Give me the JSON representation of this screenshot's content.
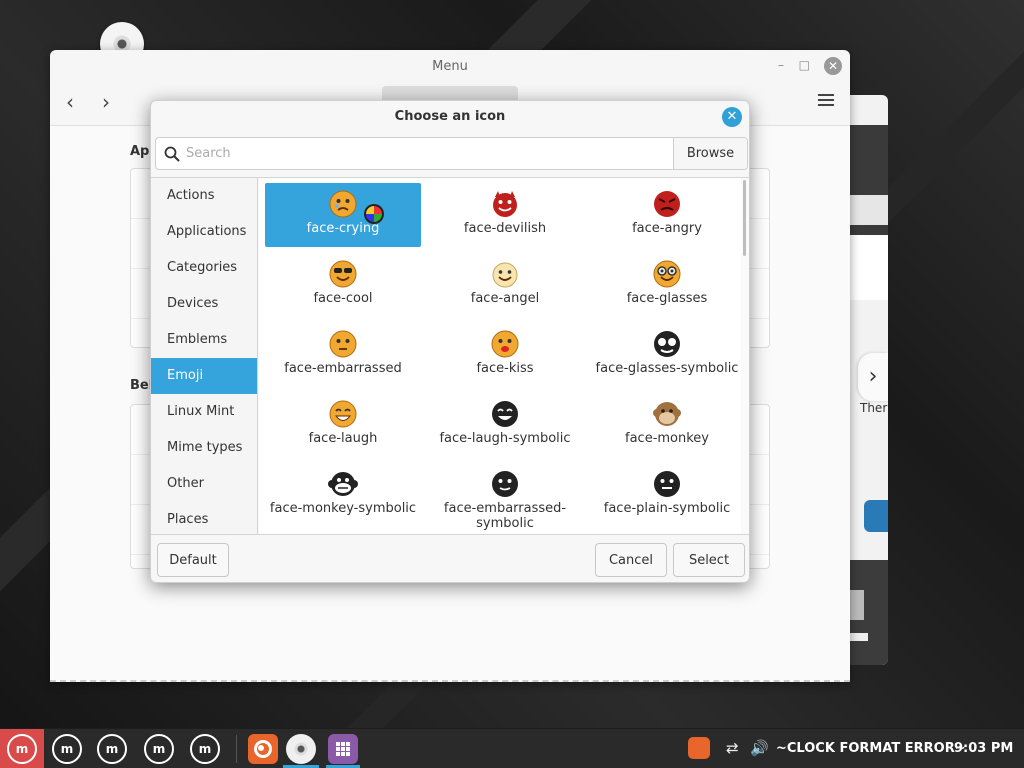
{
  "menu_window": {
    "title": "Menu",
    "section1_label": "App",
    "section2_label": "Beh"
  },
  "bg_window": {
    "theme_label": "Ther"
  },
  "dialog": {
    "title": "Choose an icon",
    "search_placeholder": "Search",
    "browse_label": "Browse",
    "categories": [
      {
        "label": "Actions",
        "active": false
      },
      {
        "label": "Applications",
        "active": false
      },
      {
        "label": "Categories",
        "active": false
      },
      {
        "label": "Devices",
        "active": false
      },
      {
        "label": "Emblems",
        "active": false
      },
      {
        "label": "Emoji",
        "active": true
      },
      {
        "label": "Linux Mint",
        "active": false
      },
      {
        "label": "Mime types",
        "active": false
      },
      {
        "label": "Other",
        "active": false
      },
      {
        "label": "Places",
        "active": false
      }
    ],
    "icons": [
      {
        "name": "face-crying",
        "selected": true
      },
      {
        "name": "face-devilish",
        "selected": false
      },
      {
        "name": "face-angry",
        "selected": false
      },
      {
        "name": "face-cool",
        "selected": false
      },
      {
        "name": "face-angel",
        "selected": false
      },
      {
        "name": "face-glasses",
        "selected": false
      },
      {
        "name": "face-embarrassed",
        "selected": false
      },
      {
        "name": "face-kiss",
        "selected": false
      },
      {
        "name": "face-glasses-symbolic",
        "selected": false
      },
      {
        "name": "face-laugh",
        "selected": false
      },
      {
        "name": "face-laugh-symbolic",
        "selected": false
      },
      {
        "name": "face-monkey",
        "selected": false
      },
      {
        "name": "face-monkey-symbolic",
        "selected": false
      },
      {
        "name": "face-embarrassed-symbolic",
        "label_line1": "face-embarrassed-",
        "label_line2": "symbolic",
        "selected": false
      },
      {
        "name": "face-plain-symbolic",
        "selected": false
      }
    ],
    "default_label": "Default",
    "cancel_label": "Cancel",
    "select_label": "Select"
  },
  "taskbar": {
    "clock_error": "~CLOCK FORMAT ERROR~",
    "time": "9:03 PM",
    "mint_logo_text": "m"
  },
  "colors": {
    "accent": "#35a3dc",
    "menu_button": "#d94a4a"
  }
}
